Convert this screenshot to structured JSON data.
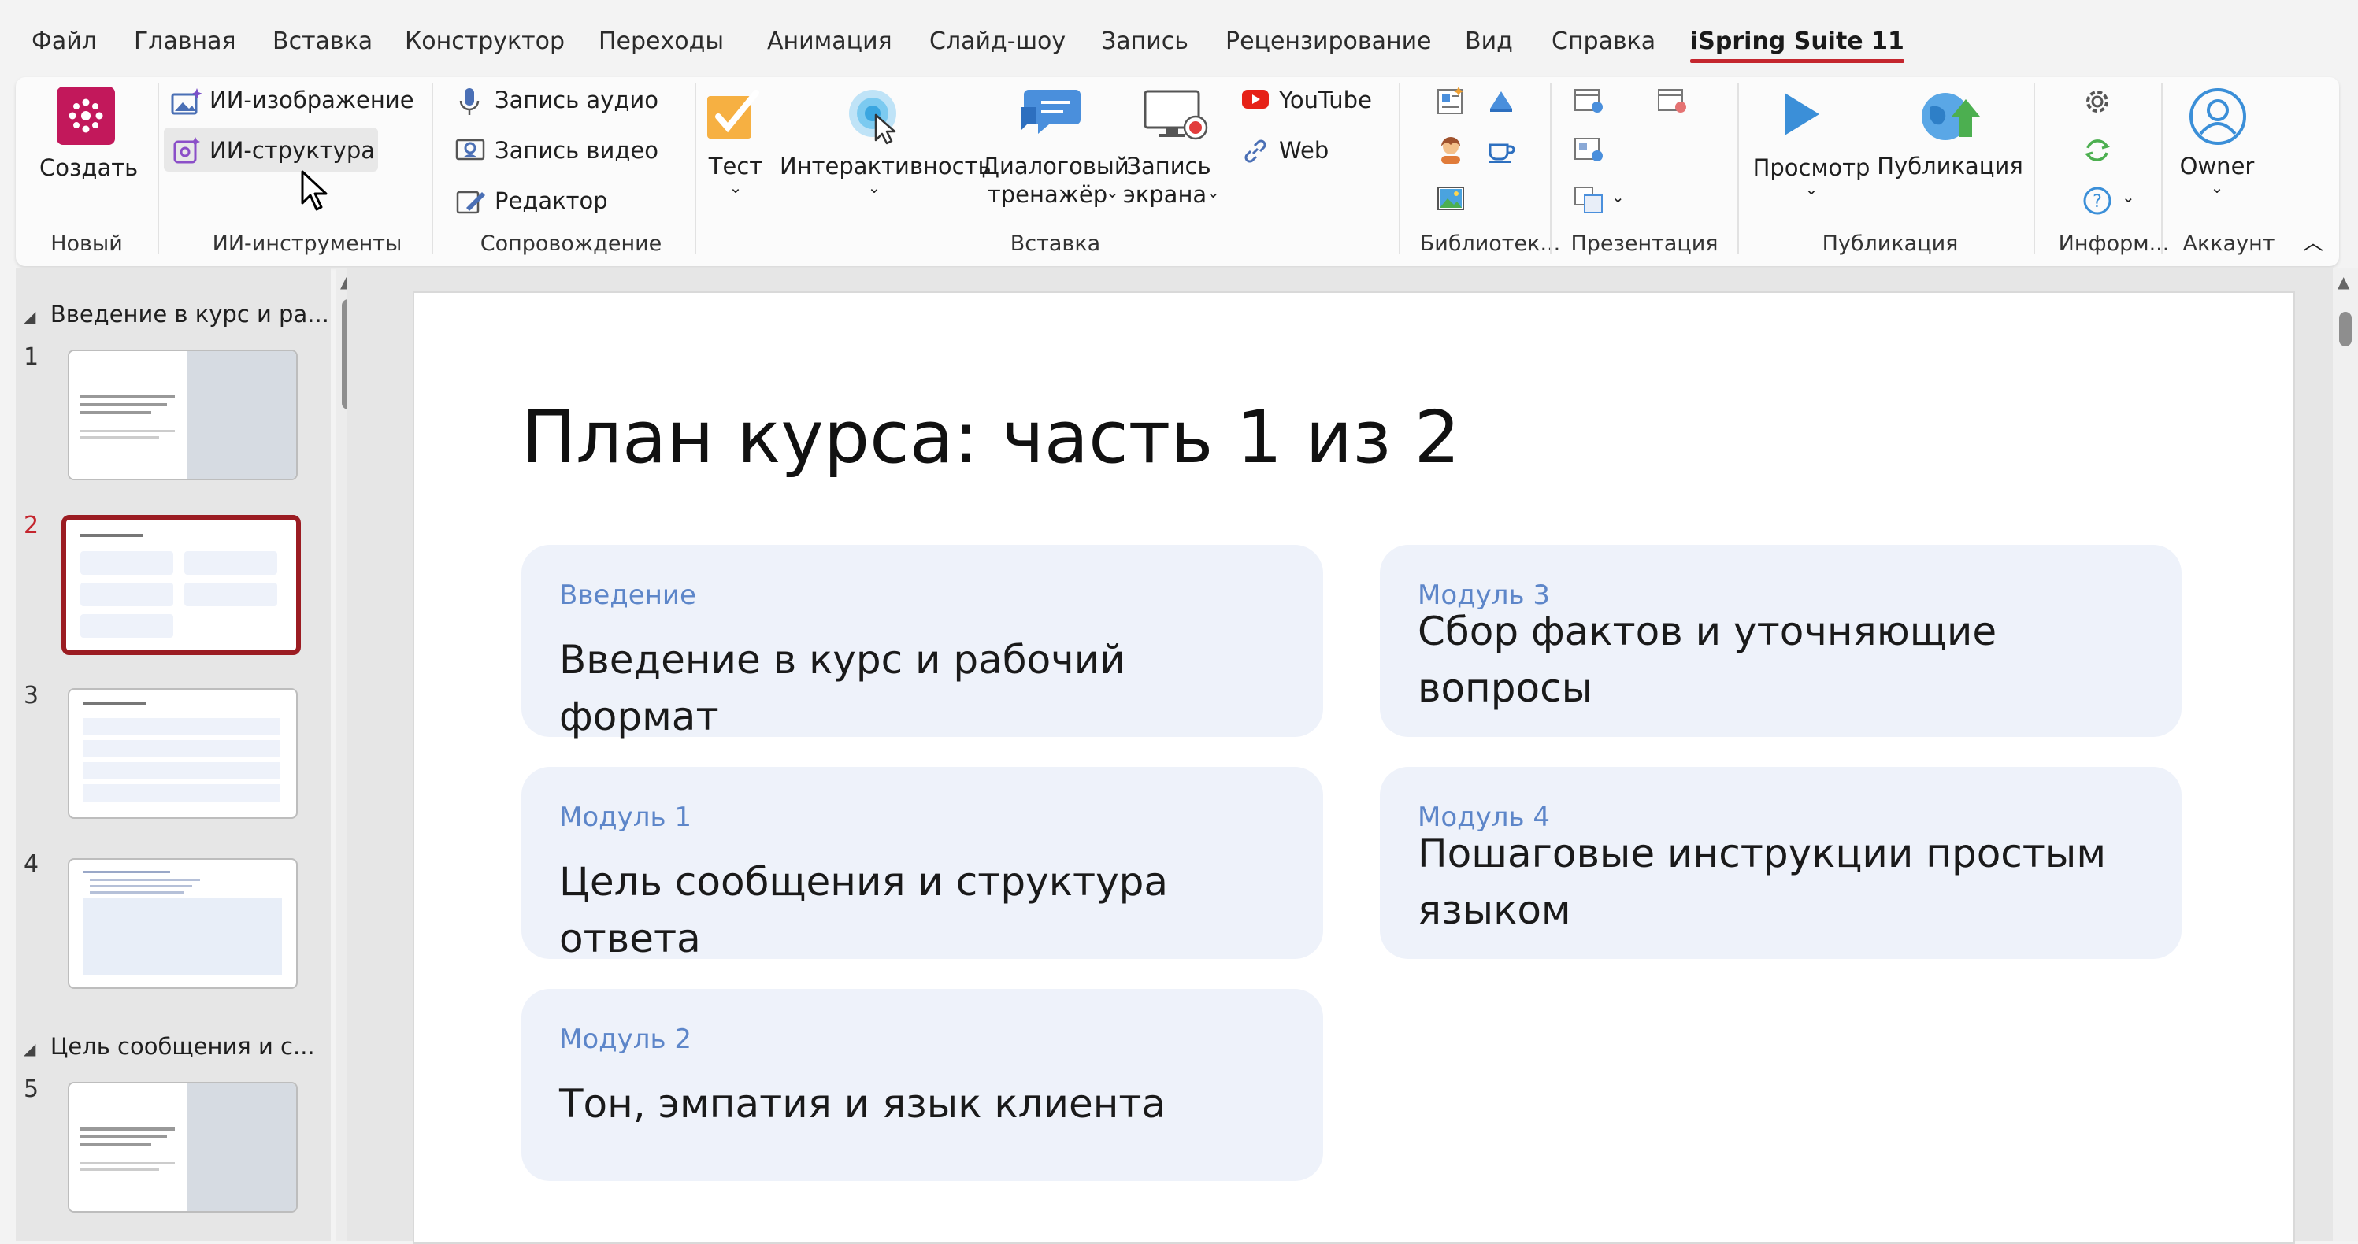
{
  "menu": {
    "tabs": [
      "Файл",
      "Главная",
      "Вставка",
      "Конструктор",
      "Переходы",
      "Анимация",
      "Слайд-шоу",
      "Запись",
      "Рецензирование",
      "Вид",
      "Справка",
      "iSpring Suite 11"
    ]
  },
  "ribbon": {
    "new_group": {
      "create_label": "Создать",
      "group_label": "Новый"
    },
    "ai_group": {
      "ai_image": "ИИ-изображение",
      "ai_structure": "ИИ-структура",
      "group_label": "ИИ-инструменты"
    },
    "accomp_group": {
      "record_audio": "Запись аудио",
      "record_video": "Запись видео",
      "editor": "Редактор",
      "group_label": "Сопровождение"
    },
    "insert_group": {
      "test": "Тест",
      "interactivity": "Интерактивность",
      "dialog_line1": "Диалоговый",
      "dialog_line2": "тренажёр",
      "screen_line1": "Запись",
      "screen_line2": "экрана",
      "youtube": "YouTube",
      "web": "Web",
      "group_label": "Вставка"
    },
    "library_group": {
      "group_label": "Библиотек..."
    },
    "presentation_group": {
      "group_label": "Презентация"
    },
    "publish_group": {
      "preview": "Просмотр",
      "publish": "Публикация",
      "group_label": "Публикация"
    },
    "info_group": {
      "group_label": "Информ..."
    },
    "account_group": {
      "owner": "Owner",
      "group_label": "Аккаунт"
    },
    "colors": {
      "accent_red": "#c4262e",
      "create_tile": "#c2185b",
      "youtube_red": "#e62117"
    }
  },
  "slides_panel": {
    "sections": [
      "Введение в курс и ра...",
      "Цель сообщения и с..."
    ],
    "slide_numbers": [
      "1",
      "2",
      "3",
      "4",
      "5"
    ],
    "selected_slide": 2
  },
  "slide": {
    "title": "План курса: часть 1 из 2",
    "cards": [
      {
        "tag": "Введение",
        "text": "Введение в курс и рабочий формат"
      },
      {
        "tag": "Модуль 1",
        "text": "Цель сообщения и структура ответа"
      },
      {
        "tag": "Модуль 2",
        "text": "Тон, эмпатия и язык клиента"
      },
      {
        "tag": "Модуль 3",
        "text": "Сбор фактов и уточняющие вопросы"
      },
      {
        "tag": "Модуль 4",
        "text": "Пошаговые инструкции простым языком"
      }
    ]
  }
}
